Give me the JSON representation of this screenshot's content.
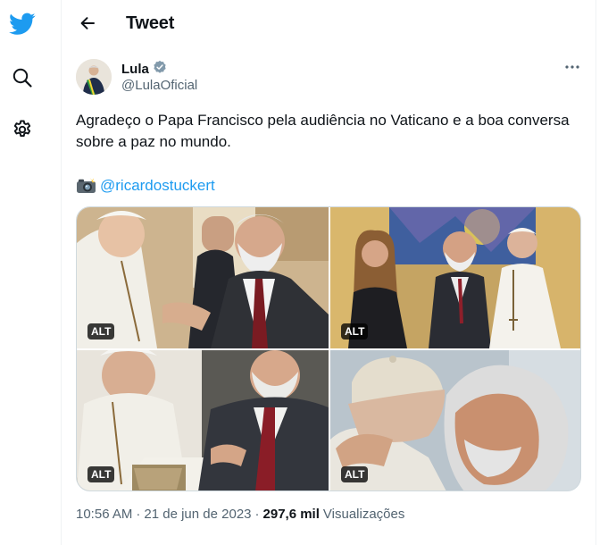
{
  "header": {
    "title": "Tweet"
  },
  "nav": {
    "icons": [
      "twitter-bird-icon",
      "search-icon",
      "settings-icon"
    ]
  },
  "author": {
    "name": "Lula",
    "handle": "@LulaOficial",
    "verified": true
  },
  "tweet": {
    "text": "Agradeço o Papa Francisco pela audiência no Vaticano e a boa conversa sobre a paz no mundo.",
    "credit_emoji": "camera-with-flash-icon",
    "credit_mention": "@ricardostuckert"
  },
  "media": [
    {
      "alt_label": "ALT"
    },
    {
      "alt_label": "ALT"
    },
    {
      "alt_label": "ALT"
    },
    {
      "alt_label": "ALT"
    }
  ],
  "meta": {
    "time": "10:56 AM",
    "separator": "·",
    "date": "21 de jun de 2023",
    "views_count": "297,6 mil",
    "views_label": "Visualizações"
  },
  "colors": {
    "accent": "#1d9bf0",
    "text_primary": "#0f1419",
    "text_secondary": "#536471",
    "border": "#cfd9de"
  }
}
